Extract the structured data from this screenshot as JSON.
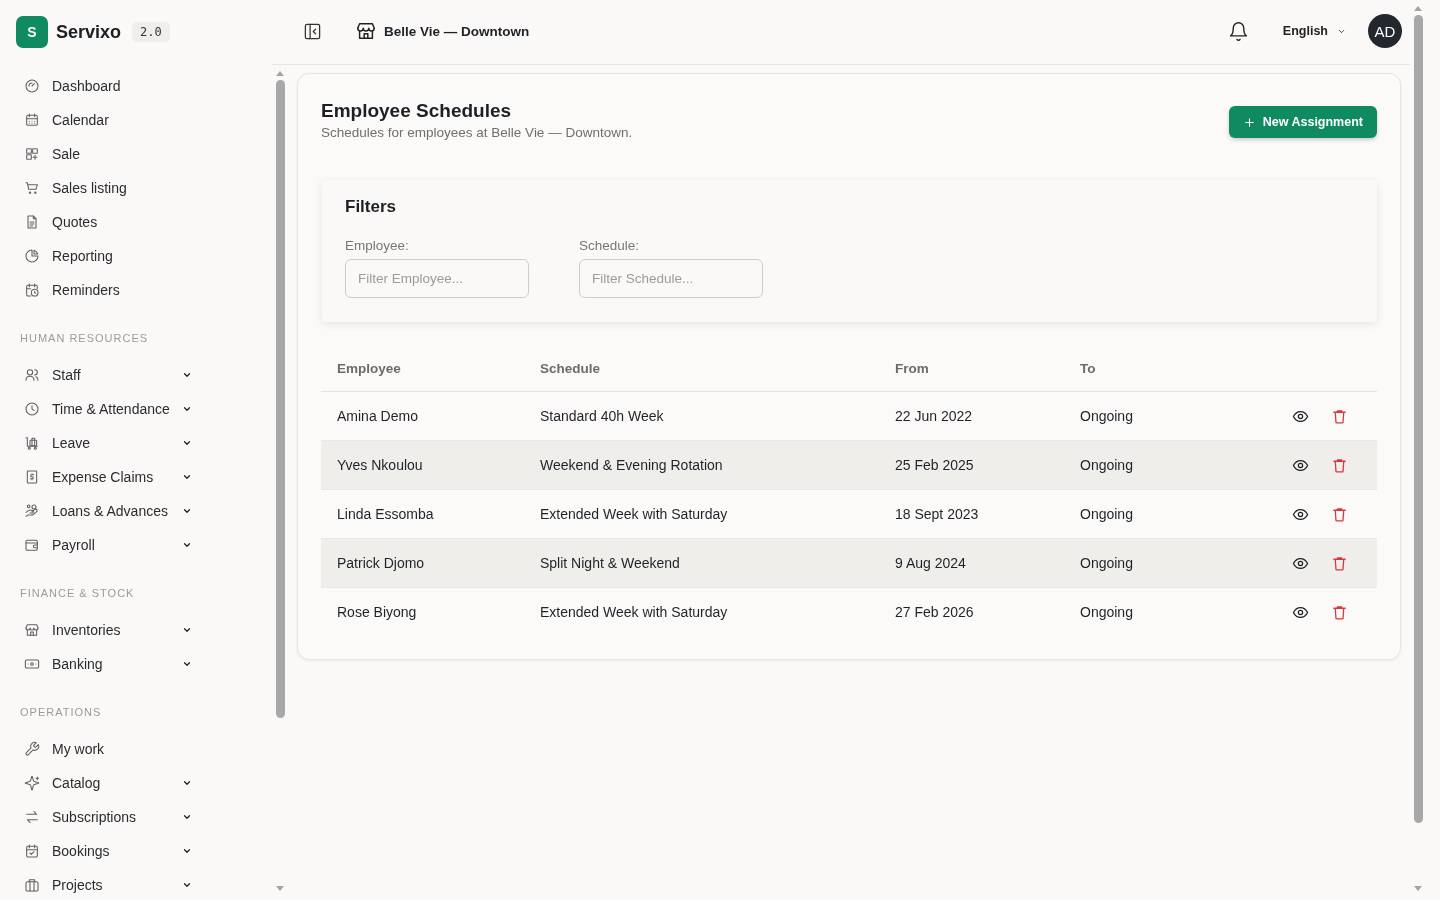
{
  "brand": {
    "logo_letter": "S",
    "name": "Servixo",
    "version": "2.0"
  },
  "sidebar": {
    "sections": [
      {
        "items": [
          {
            "label": "Dashboard",
            "expandable": false
          },
          {
            "label": "Calendar",
            "expandable": false
          },
          {
            "label": "Sale",
            "expandable": false
          },
          {
            "label": "Sales listing",
            "expandable": false
          },
          {
            "label": "Quotes",
            "expandable": false
          },
          {
            "label": "Reporting",
            "expandable": false
          },
          {
            "label": "Reminders",
            "expandable": false
          }
        ]
      },
      {
        "title": "HUMAN RESOURCES",
        "items": [
          {
            "label": "Staff",
            "expandable": true
          },
          {
            "label": "Time & Attendance",
            "expandable": true
          },
          {
            "label": "Leave",
            "expandable": true
          },
          {
            "label": "Expense Claims",
            "expandable": true
          },
          {
            "label": "Loans & Advances",
            "expandable": true
          },
          {
            "label": "Payroll",
            "expandable": true
          }
        ]
      },
      {
        "title": "FINANCE & STOCK",
        "items": [
          {
            "label": "Inventories",
            "expandable": true
          },
          {
            "label": "Banking",
            "expandable": true
          }
        ]
      },
      {
        "title": "OPERATIONS",
        "items": [
          {
            "label": "My work",
            "expandable": false
          },
          {
            "label": "Catalog",
            "expandable": true
          },
          {
            "label": "Subscriptions",
            "expandable": true
          },
          {
            "label": "Bookings",
            "expandable": true
          },
          {
            "label": "Projects",
            "expandable": true
          }
        ]
      }
    ]
  },
  "header": {
    "location": "Belle Vie — Downtown",
    "language": "English",
    "avatar_initials": "AD"
  },
  "page": {
    "title": "Employee Schedules",
    "subtitle": "Schedules for employees at Belle Vie — Downtown.",
    "new_button": "New Assignment"
  },
  "filters": {
    "title": "Filters",
    "fields": [
      {
        "label": "Employee:",
        "placeholder": "Filter Employee..."
      },
      {
        "label": "Schedule:",
        "placeholder": "Filter Schedule..."
      }
    ]
  },
  "table": {
    "columns": [
      "Employee",
      "Schedule",
      "From",
      "To"
    ],
    "rows": [
      {
        "employee": "Amina Demo",
        "schedule": "Standard 40h Week",
        "from": "22 Jun 2022",
        "to": "Ongoing"
      },
      {
        "employee": "Yves Nkoulou",
        "schedule": "Weekend & Evening Rotation",
        "from": "25 Feb 2025",
        "to": "Ongoing"
      },
      {
        "employee": "Linda Essomba",
        "schedule": "Extended Week with Saturday",
        "from": "18 Sept 2023",
        "to": "Ongoing"
      },
      {
        "employee": "Patrick Djomo",
        "schedule": "Split Night & Weekend",
        "from": "9 Aug 2024",
        "to": "Ongoing"
      },
      {
        "employee": "Rose Biyong",
        "schedule": "Extended Week with Saturday",
        "from": "27 Feb 2026",
        "to": "Ongoing"
      }
    ]
  }
}
